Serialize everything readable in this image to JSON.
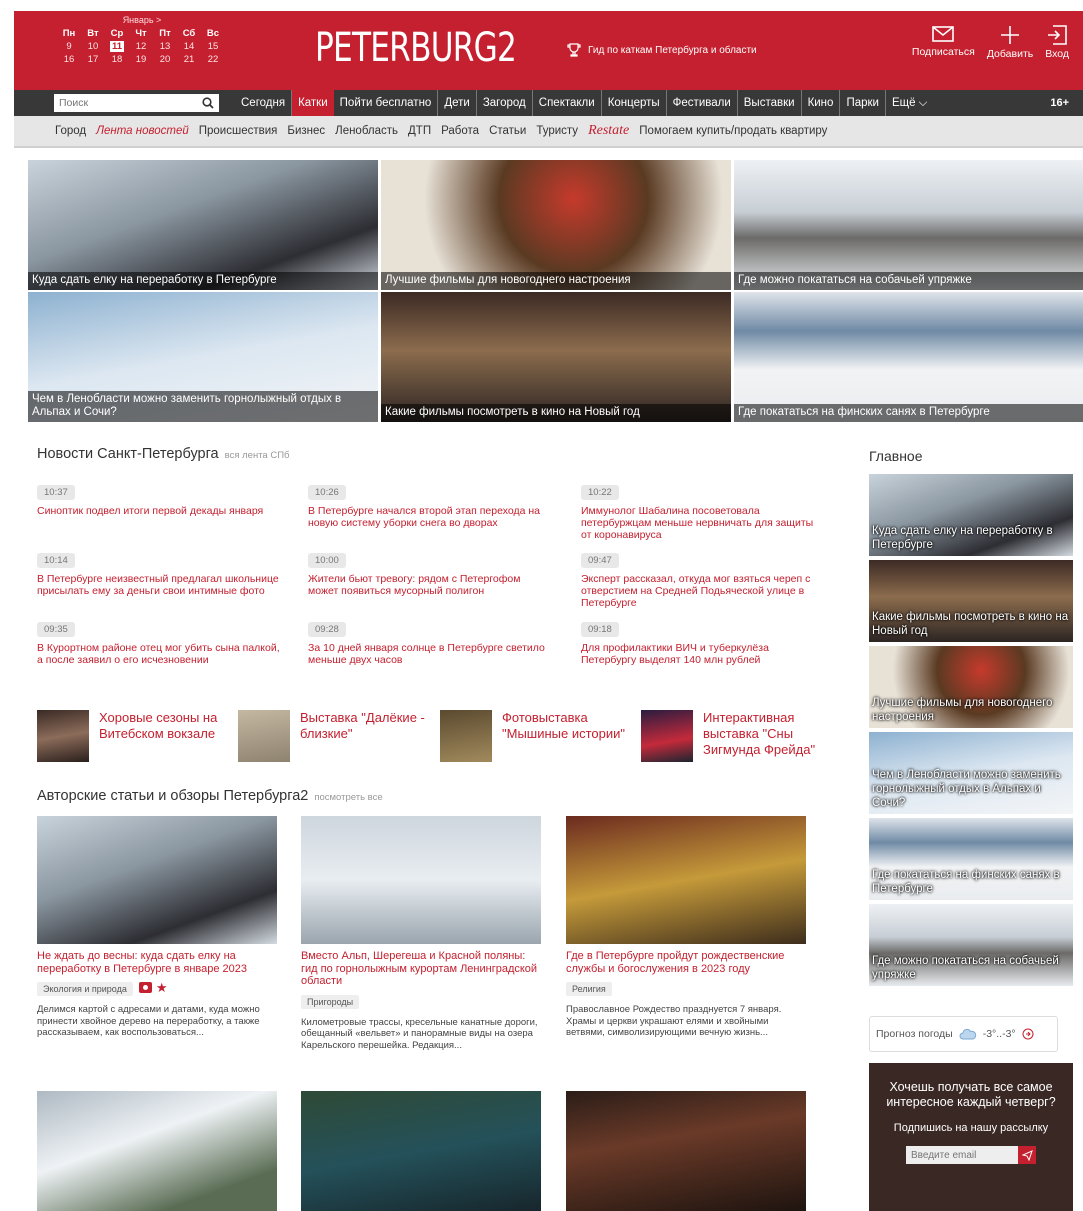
{
  "calendar": {
    "month": "Январь >",
    "days": [
      "Пн",
      "Вт",
      "Ср",
      "Чт",
      "Пт",
      "Сб",
      "Вс"
    ],
    "row1": [
      "9",
      "10",
      "11",
      "12",
      "13",
      "14",
      "15"
    ],
    "row2": [
      "16",
      "17",
      "18",
      "19",
      "20",
      "21",
      "22"
    ]
  },
  "header": {
    "logo": "PETERBURG2",
    "guide": "Гид по каткам Петербурга и области",
    "subscribe": "Подписаться",
    "add": "Добавить",
    "login": "Вход"
  },
  "nav": {
    "search_placeholder": "Поиск",
    "items": [
      "Сегодня",
      "Катки",
      "Пойти бесплатно",
      "Дети",
      "Загород",
      "Спектакли",
      "Концерты",
      "Фестивали",
      "Выставки",
      "Кино",
      "Парки",
      "Ещё ⌵"
    ],
    "age": "16+"
  },
  "subnav": {
    "items": [
      "Город",
      "Лента новостей",
      "Происшествия",
      "Бизнес",
      "Ленобласть",
      "ДТП",
      "Работа",
      "Статьи",
      "Туристу"
    ],
    "restate": "Restate",
    "buysell": "Помогаем купить/продать квартиру"
  },
  "tiles": [
    "Куда сдать елку на переработку в Петербурге",
    "Лучшие фильмы для новогоднего настроения",
    "Где можно покататься на собачьей упряжке",
    "Чем в Ленобласти можно заменить горнолыжный отдых в Альпах и Сочи?",
    "Какие фильмы посмотреть в кино на Новый год",
    "Где покататься на финских санях в Петербурге"
  ],
  "news": {
    "title": "Новости Санкт-Петербурга",
    "more": "вся лента СПб",
    "items": [
      {
        "time": "10:37",
        "text": "Синоптик подвел итоги первой декады января"
      },
      {
        "time": "10:26",
        "text": "В Петербурге начался второй этап перехода на новую систему уборки снега во дворах"
      },
      {
        "time": "10:22",
        "text": "Иммунолог Шабалина посоветовала петербуржцам меньше нервничать для защиты от коронавируса"
      },
      {
        "time": "10:14",
        "text": "В Петербурге неизвестный предлагал школьнице присылать ему за деньги свои интимные фото"
      },
      {
        "time": "10:00",
        "text": "Жители бьют тревогу: рядом с Петергофом может появиться мусорный полигон"
      },
      {
        "time": "09:47",
        "text": "Эксперт рассказал, откуда мог взяться череп с отверстием на Средней Подьяческой улице в Петербурге"
      },
      {
        "time": "09:35",
        "text": "В Курортном районе отец мог убить сына палкой, а после заявил о его исчезновении"
      },
      {
        "time": "09:28",
        "text": "За 10 дней января солнце в Петербурге светило меньше двух часов"
      },
      {
        "time": "09:18",
        "text": "Для профилактики ВИЧ и туберкулёза Петербургу выделят 140 млн рублей"
      }
    ]
  },
  "featured": [
    "Хоровые сезоны на Витебском вокзале",
    "Выставка \"Далёкие - близкие\"",
    "Фотовыставка \"Мышиные истории\"",
    "Интерактивная выставка \"Сны Зигмунда Фрейда\""
  ],
  "articles": {
    "title": "Авторские статьи и обзоры Петербурга2",
    "more": "посмотреть все",
    "items": [
      {
        "title": "Не ждать до весны: куда сдать елку на переработку в Петербурге в январе 2023",
        "tag": "Экология и природа",
        "desc": "Делимся картой с адресами и датами, куда можно принести хвойное дерево на переработку, а также рассказываем, как воспользоваться..."
      },
      {
        "title": "Вместо Альп, Шерегеша и Красной поляны: гид по горнолыжным курортам Ленинградской области",
        "tag": "Пригороды",
        "desc": "Километровые трассы, кресельные канатные дороги, обещанный «вельвет» и панорамные виды на озера Карельского перешейка. Редакция..."
      },
      {
        "title": "Где в Петербурге пройдут рождественские службы и богослужения в 2023 году",
        "tag": "Религия",
        "desc": "Православное Рождество празднуется 7 января. Храмы и церкви украшают елями и хвойными ветвями, символизирующими вечную жизнь..."
      }
    ]
  },
  "sidebar": {
    "title": "Главное",
    "items": [
      "Куда сдать елку на переработку в Петербурге",
      "Какие фильмы посмотреть в кино на Новый год",
      "Лучшие фильмы для новогоднего настроения",
      "Чем в Ленобласти можно заменить горнолыжный отдых в Альпах и Сочи?",
      "Где покататься на финских санях в Петербурге",
      "Где можно покататься на собачьей упряжке"
    ],
    "weather_label": "Прогноз погоды",
    "weather_temp": "-3°..-3°",
    "subscribe_heading": "Хочешь получать все самое интересное каждый четверг?",
    "subscribe_cta": "Подпишись на нашу рассылку",
    "email_placeholder": "Введите email"
  },
  "colors": {
    "brand": "#c4202f",
    "nav": "#383838"
  }
}
